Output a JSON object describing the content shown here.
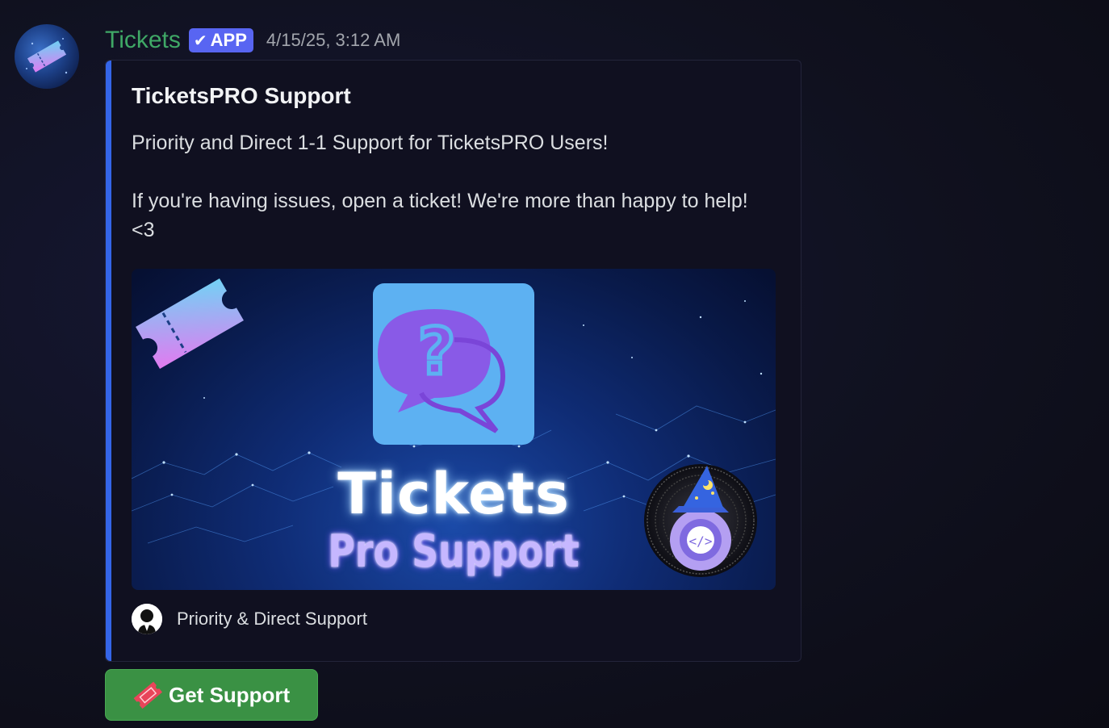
{
  "message": {
    "author": "Tickets",
    "badge": "APP",
    "timestamp": "4/15/25, 3:12 AM",
    "avatar_icon": "ticket-icon"
  },
  "embed": {
    "accent_color": "#3465e8",
    "title": "TicketsPRO Support",
    "description": "Priority and Direct 1-1 Support for TicketsPRO Users!\n\nIf you're having issues, open a ticket! We're more than happy to help! <3",
    "image": {
      "headline": "Tickets",
      "subheadline": "Pro Support",
      "icons": [
        "ticket-icon",
        "question-chat-bubble-icon",
        "wizard-gear-icon"
      ]
    },
    "footer": {
      "text": "Priority & Direct Support",
      "icon": "support-agent-icon"
    }
  },
  "buttons": [
    {
      "label": "Get Support",
      "icon": "ticket-icon",
      "color": "#3a9144"
    }
  ]
}
